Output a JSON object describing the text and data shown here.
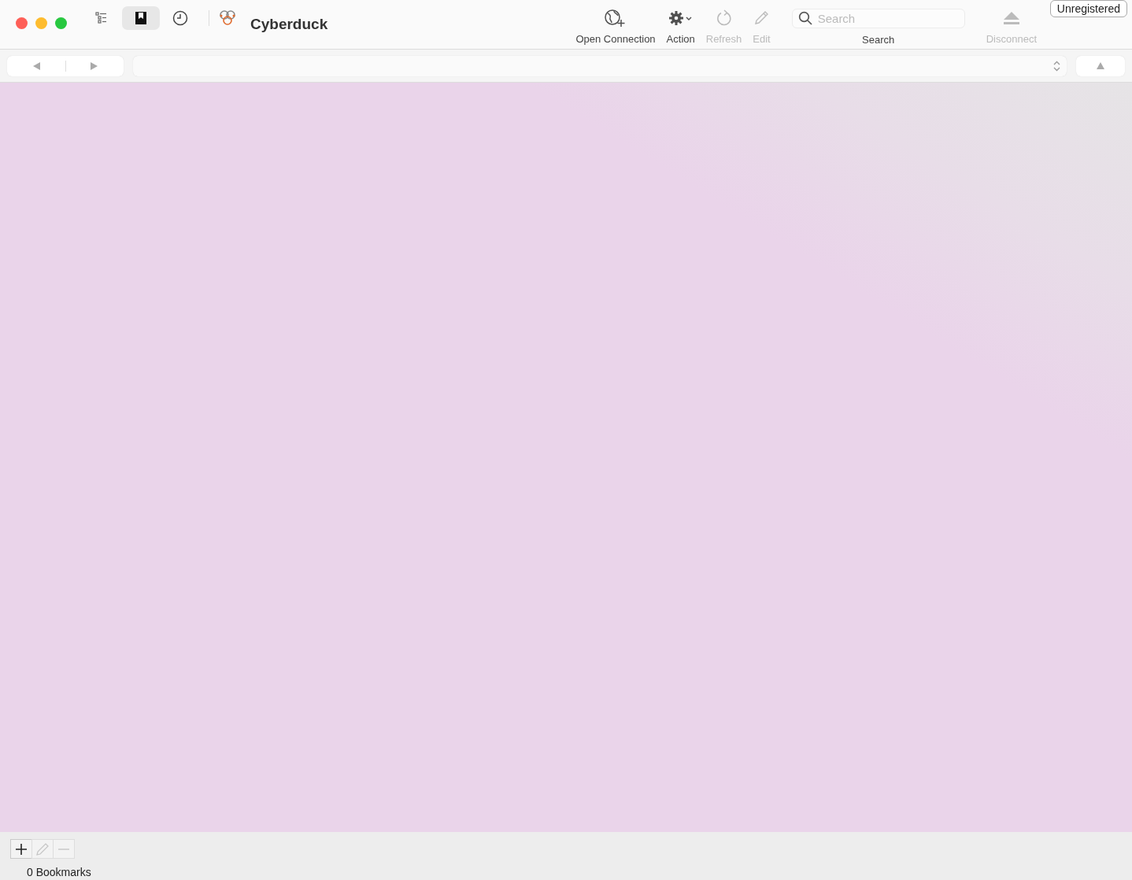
{
  "window": {
    "title": "Cyberduck",
    "badge": "Unregistered"
  },
  "view_buttons": [
    {
      "kind": "outline",
      "selected": false
    },
    {
      "kind": "bookmarks",
      "selected": true
    },
    {
      "kind": "history",
      "selected": false
    }
  ],
  "toolbar_items": [
    {
      "kind": "connect",
      "label": "Open Connection",
      "disabled": false
    },
    {
      "kind": "action",
      "label": "Action",
      "disabled": false
    },
    {
      "kind": "refresh",
      "label": "Refresh",
      "disabled": true
    },
    {
      "kind": "edit",
      "label": "Edit",
      "disabled": true
    },
    {
      "kind": "search",
      "label": "Search",
      "placeholder": "Search"
    },
    {
      "kind": "disconnect",
      "label": "Disconnect",
      "disabled": true
    }
  ],
  "bottom_buttons": [
    {
      "kind": "add",
      "disabled": false
    },
    {
      "kind": "edit",
      "disabled": true
    },
    {
      "kind": "remove",
      "disabled": true
    }
  ],
  "status_bar": {
    "text": "0 Bookmarks"
  }
}
